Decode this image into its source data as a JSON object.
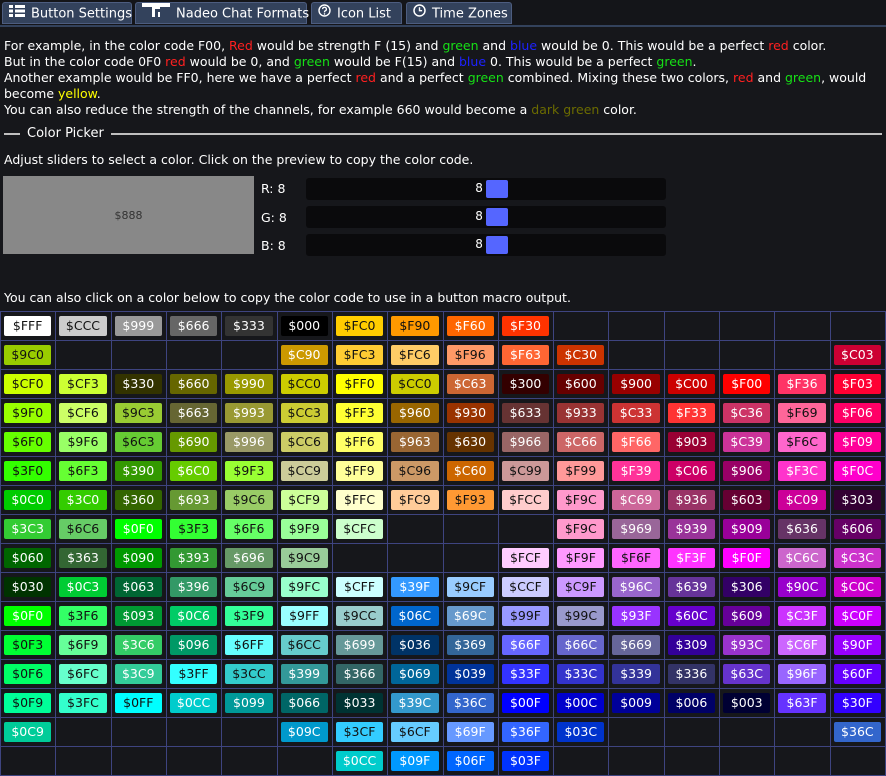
{
  "tabs": [
    {
      "label": "Button Settings",
      "icon": "grid-icon"
    },
    {
      "label": "Nadeo Chat Formats",
      "icon": "trackmania-logo-icon"
    },
    {
      "label": "Icon List",
      "icon": "question-circle-icon"
    },
    {
      "label": "Time Zones",
      "icon": "clock-icon"
    }
  ],
  "intro": {
    "l1": {
      "a": "For example, in the color code F00, ",
      "red": "Red",
      "b": " would be strength F (15) and ",
      "green": "green",
      "c": " and ",
      "blue": "blue",
      "d": " would be 0. This would be a perfect ",
      "red2": "red",
      "e": " color."
    },
    "l2": {
      "a": "But in the color code 0F0 ",
      "red": "red",
      "b": " would be 0, and ",
      "green": "green",
      "c": " would be F(15) and ",
      "blue": "blue",
      "d": " 0. This would be a perfect ",
      "green2": "green",
      "e": "."
    },
    "l3": {
      "a": "Another example would be FF0, here we have a perfect ",
      "red": "red",
      "b": " and a perfect ",
      "green": "green",
      "c": " combined. Mixing these two colors, ",
      "red2": "red",
      "d": " and ",
      "green2": "green",
      "e": ", would"
    },
    "l4": {
      "a": "become ",
      "yellow": "yellow",
      "b": "."
    },
    "l5": {
      "a": "You can also reduce the strength of the channels, for example 660 would become a ",
      "dark": "dark green",
      "b": " color."
    }
  },
  "picker": {
    "legend": "Color Picker",
    "instructions": "Adjust sliders to select a color. Click on the preview to copy the color code.",
    "preview_text": "$888",
    "preview_color": "#888888",
    "sliders": [
      {
        "label": "R: 8",
        "value": "8",
        "level": 0.5333,
        "fill": "#ff1a1a"
      },
      {
        "label": "G: 8",
        "value": "8",
        "level": 0.5333,
        "fill": "#11dd11"
      },
      {
        "label": "B: 8",
        "value": "8",
        "level": 0.5333,
        "fill": "#5566ff"
      }
    ]
  },
  "palette": {
    "caption": "You can also click on a color below to copy the color code to use in a button macro output.",
    "rows": [
      [
        "FFF",
        "CCC",
        "999",
        "666",
        "333",
        "000",
        "FC0",
        "F90",
        "F60",
        "F30",
        "",
        "",
        "",
        "",
        "",
        ""
      ],
      [
        "9C0",
        "",
        "",
        "",
        "",
        "C90",
        "FC3",
        "FC6",
        "F96",
        "F63",
        "C30",
        "",
        "",
        "",
        "",
        "C03"
      ],
      [
        "CF0",
        "CF3",
        "330",
        "660",
        "990",
        "CC0",
        "FF0",
        "CC0",
        "C63",
        "300",
        "600",
        "900",
        "C00",
        "F00",
        "F36",
        "F03"
      ],
      [
        "9F0",
        "CF6",
        "9C3",
        "663",
        "993",
        "CC3",
        "FF3",
        "960",
        "930",
        "633",
        "933",
        "C33",
        "F33",
        "C36",
        "F69",
        "F06"
      ],
      [
        "6F0",
        "9F6",
        "6C3",
        "690",
        "996",
        "CC6",
        "FF6",
        "963",
        "630",
        "966",
        "C66",
        "F66",
        "903",
        "C39",
        "F6C",
        "F09"
      ],
      [
        "3F0",
        "6F3",
        "390",
        "6C0",
        "9F3",
        "CC9",
        "FF9",
        "C96",
        "C60",
        "C99",
        "F99",
        "F39",
        "C06",
        "906",
        "F3C",
        "F0C"
      ],
      [
        "0C0",
        "3C0",
        "360",
        "693",
        "9C6",
        "CF9",
        "FFC",
        "FC9",
        "F93",
        "FCC",
        "F9C",
        "C69",
        "936",
        "603",
        "C09",
        "303"
      ],
      [
        "3C3",
        "6C6",
        "0F0",
        "3F3",
        "6F6",
        "9F9",
        "CFC",
        "",
        "",
        "",
        "F9C",
        "969",
        "939",
        "909",
        "636",
        "606"
      ],
      [
        "060",
        "363",
        "090",
        "393",
        "696",
        "9C9",
        "",
        "",
        "",
        "FCF",
        "F9F",
        "F6F",
        "F3F",
        "F0F",
        "C6C",
        "C3C"
      ],
      [
        "030",
        "0C3",
        "063",
        "396",
        "6C9",
        "9FC",
        "CFF",
        "39F",
        "9CF",
        "CCF",
        "C9F",
        "96C",
        "639",
        "306",
        "90C",
        "C0C"
      ],
      [
        "0F0",
        "3F6",
        "093",
        "0C6",
        "3F9",
        "9FF",
        "9CC",
        "06C",
        "69C",
        "99F",
        "99C",
        "93F",
        "60C",
        "609",
        "C3F",
        "C0F"
      ],
      [
        "0F3",
        "6F9",
        "3C6",
        "096",
        "6FF",
        "6CC",
        "699",
        "036",
        "369",
        "66F",
        "66C",
        "669",
        "309",
        "93C",
        "C6F",
        "90F"
      ],
      [
        "0F6",
        "6FC",
        "3C9",
        "3FF",
        "3CC",
        "399",
        "366",
        "069",
        "039",
        "33F",
        "33C",
        "339",
        "336",
        "63C",
        "96F",
        "60F"
      ],
      [
        "0F9",
        "3FC",
        "0FF",
        "0CC",
        "099",
        "066",
        "033",
        "39C",
        "36C",
        "00F",
        "00C",
        "009",
        "006",
        "003",
        "63F",
        "30F"
      ],
      [
        "0C9",
        "",
        "",
        "",
        "",
        "09C",
        "3CF",
        "6CF",
        "69F",
        "36F",
        "03C",
        "",
        "",
        "",
        "",
        "36C"
      ],
      [
        "",
        "",
        "",
        "",
        "",
        "",
        "0CC",
        "09F",
        "06F",
        "03F",
        "",
        "",
        "",
        "",
        "",
        ""
      ]
    ]
  }
}
